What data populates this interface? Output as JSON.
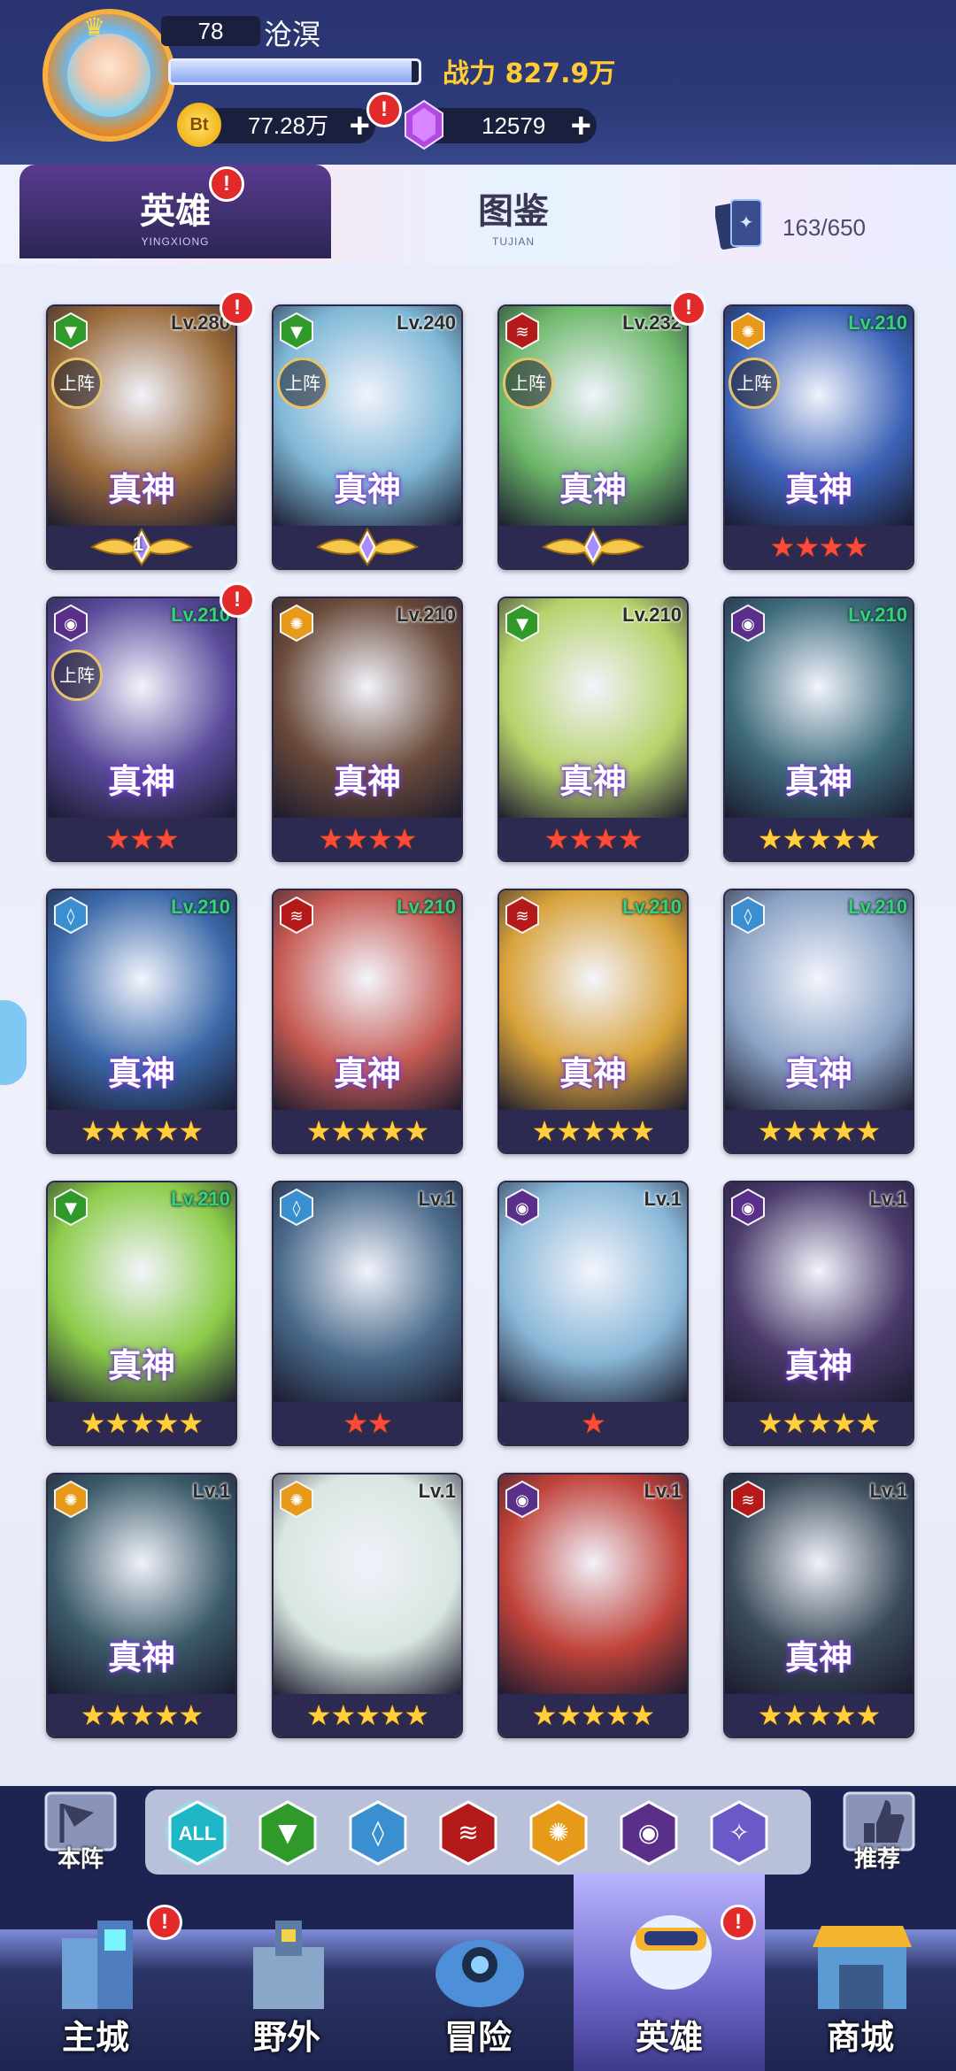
{
  "player": {
    "level": "78",
    "name": "沧溟",
    "exp_fraction": 0.97,
    "power_label": "战力 827.9万",
    "gold": "77.28万",
    "gems": "12579",
    "gold_coin_text": "Bt"
  },
  "tabs": [
    {
      "label": "英雄",
      "sub": "YINGXIONG",
      "active": true,
      "badge": "!"
    },
    {
      "label": "图鉴",
      "sub": "TUJIAN",
      "active": false
    }
  ],
  "collection_count": "163/650",
  "deploy_label": "上阵",
  "rank_label": "真神",
  "heroes": [
    {
      "element": "nature",
      "level": "Lv.280",
      "level_green": false,
      "deployed": true,
      "rank": true,
      "stars": 0,
      "medal": "1",
      "badge": true,
      "art": "#9a6a3a"
    },
    {
      "element": "nature",
      "level": "Lv.240",
      "level_green": false,
      "deployed": true,
      "rank": true,
      "stars": 0,
      "medal": "",
      "badge": false,
      "art": "#7fb8d6"
    },
    {
      "element": "fire",
      "level": "Lv.232",
      "level_green": false,
      "deployed": true,
      "rank": true,
      "stars": 0,
      "medal": "",
      "badge": true,
      "art": "#6db86a"
    },
    {
      "element": "light",
      "level": "Lv.210",
      "level_green": true,
      "deployed": true,
      "rank": true,
      "stars": 4,
      "star_color": "red",
      "badge": false,
      "art": "#3b62b5"
    },
    {
      "element": "dark",
      "level": "Lv.210",
      "level_green": true,
      "deployed": true,
      "rank": true,
      "stars": 3,
      "star_color": "red",
      "badge": true,
      "art": "#5a4a9a"
    },
    {
      "element": "light",
      "level": "Lv.210",
      "level_green": false,
      "deployed": false,
      "rank": true,
      "stars": 4,
      "star_color": "red",
      "badge": false,
      "art": "#6a4a3a"
    },
    {
      "element": "nature",
      "level": "Lv.210",
      "level_green": false,
      "deployed": false,
      "rank": true,
      "stars": 4,
      "star_color": "red",
      "badge": false,
      "art": "#b7d26b"
    },
    {
      "element": "dark",
      "level": "Lv.210",
      "level_green": true,
      "deployed": false,
      "rank": true,
      "stars": 5,
      "star_color": "gold",
      "badge": false,
      "art": "#3d6a7a"
    },
    {
      "element": "water",
      "level": "Lv.210",
      "level_green": true,
      "deployed": false,
      "rank": true,
      "stars": 5,
      "star_color": "gold",
      "badge": false,
      "art": "#3a68a8"
    },
    {
      "element": "fire",
      "level": "Lv.210",
      "level_green": true,
      "deployed": false,
      "rank": true,
      "stars": 5,
      "star_color": "gold",
      "badge": false,
      "art": "#c65b53"
    },
    {
      "element": "fire",
      "level": "Lv.210",
      "level_green": true,
      "deployed": false,
      "rank": true,
      "stars": 5,
      "star_color": "gold",
      "badge": false,
      "art": "#d8a23a"
    },
    {
      "element": "water",
      "level": "Lv.210",
      "level_green": true,
      "deployed": false,
      "rank": true,
      "stars": 5,
      "star_color": "gold",
      "badge": false,
      "art": "#8aa2c4"
    },
    {
      "element": "nature",
      "level": "Lv.210",
      "level_green": true,
      "deployed": false,
      "rank": true,
      "stars": 5,
      "star_color": "gold",
      "badge": false,
      "art": "#8ccc4a"
    },
    {
      "element": "water",
      "level": "Lv.1",
      "level_green": false,
      "deployed": false,
      "rank": false,
      "stars": 2,
      "star_color": "red",
      "badge": false,
      "art": "#4a6a8a"
    },
    {
      "element": "dark",
      "level": "Lv.1",
      "level_green": false,
      "deployed": false,
      "rank": false,
      "stars": 1,
      "star_color": "red",
      "badge": false,
      "art": "#8ab8d8"
    },
    {
      "element": "dark",
      "level": "Lv.1",
      "level_green": false,
      "deployed": false,
      "rank": true,
      "stars": 5,
      "star_color": "gold",
      "badge": false,
      "art": "#4a3a6a"
    },
    {
      "element": "light",
      "level": "Lv.1",
      "level_green": false,
      "deployed": false,
      "rank": true,
      "stars": 5,
      "star_color": "gold",
      "badge": false,
      "art": "#3b5a68"
    },
    {
      "element": "light",
      "level": "Lv.1",
      "level_green": false,
      "deployed": false,
      "rank": false,
      "stars": 5,
      "star_color": "gold",
      "badge": false,
      "art": "#d9e6e0"
    },
    {
      "element": "dark",
      "level": "Lv.1",
      "level_green": false,
      "deployed": false,
      "rank": false,
      "stars": 5,
      "star_color": "gold",
      "badge": false,
      "art": "#c0433a"
    },
    {
      "element": "fire",
      "level": "Lv.1",
      "level_green": false,
      "deployed": false,
      "rank": true,
      "stars": 5,
      "star_color": "gold",
      "badge": false,
      "art": "#3a4a58"
    }
  ],
  "element_colors": {
    "nature": "#2f9a2a",
    "fire": "#b51a1a",
    "water": "#3a8fd0",
    "light": "#e79a1a",
    "dark": "#5a2f8a",
    "spirit": "#6a5ac8"
  },
  "filters": [
    {
      "key": "all",
      "label": "ALL",
      "active": true
    },
    {
      "key": "nature",
      "label": "",
      "active": false
    },
    {
      "key": "water",
      "label": "",
      "active": false
    },
    {
      "key": "fire",
      "label": "",
      "active": false
    },
    {
      "key": "light",
      "label": "",
      "active": false
    },
    {
      "key": "dark",
      "label": "",
      "active": false
    },
    {
      "key": "spirit",
      "label": "",
      "active": false
    }
  ],
  "side_buttons": {
    "left": "本阵",
    "right": "推荐"
  },
  "nav": [
    {
      "label": "主城",
      "badge": true,
      "active": false,
      "icon": "city-icon"
    },
    {
      "label": "野外",
      "badge": false,
      "active": false,
      "icon": "field-icon"
    },
    {
      "label": "冒险",
      "badge": false,
      "active": false,
      "icon": "adventure-icon"
    },
    {
      "label": "英雄",
      "badge": true,
      "active": true,
      "icon": "hero-icon"
    },
    {
      "label": "商城",
      "badge": false,
      "active": false,
      "icon": "shop-icon"
    }
  ]
}
